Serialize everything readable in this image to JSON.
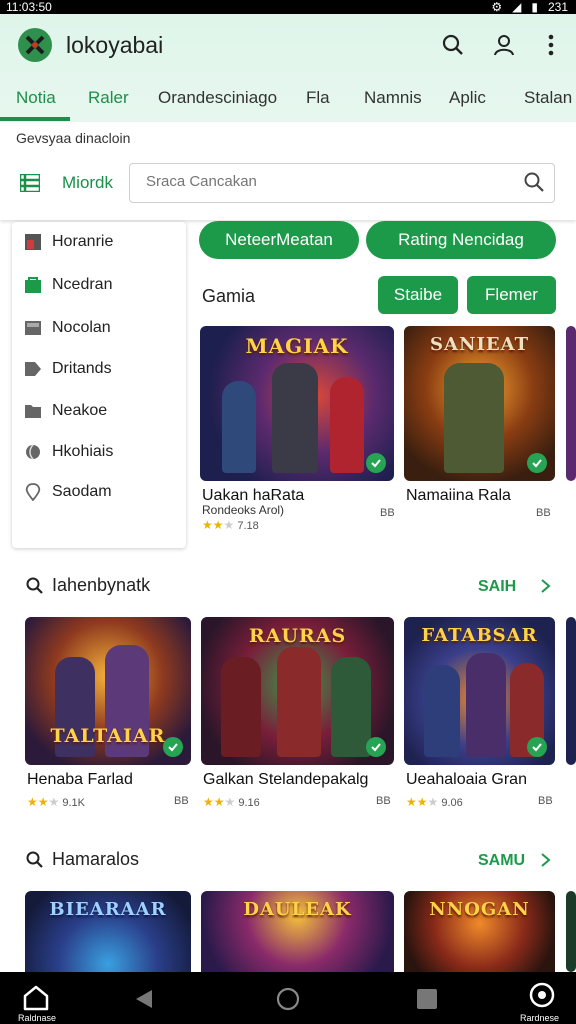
{
  "status": {
    "time": "11:03:50",
    "battery": "231"
  },
  "header": {
    "app_title": "lokoyabai",
    "tabs": [
      "Notia",
      "Raler",
      "Orandesciniago",
      "Fla",
      "Namnis",
      "Aplic",
      "Stalan"
    ]
  },
  "subbar": {
    "subtitle": "Gevsyaa dinacloin",
    "mode_label": "Miordk",
    "search_placeholder": "Sraca Cancakan"
  },
  "sidebar": {
    "items": [
      "Horanrie",
      "Ncedran",
      "Nocolan",
      "Dritands",
      "Neakoe",
      "Hkohiais",
      "Saodam"
    ]
  },
  "chips": [
    "NeteerMeatan",
    "Rating Nencidag"
  ],
  "featured": {
    "title": "Gamia",
    "buttons": [
      "Staibe",
      "Flemer"
    ],
    "cards": [
      {
        "banner": "MAGIAK",
        "title": "Uakan haRata",
        "subtitle": "Rondeoks Arol)",
        "rating": "7.18",
        "meta": "BB"
      },
      {
        "banner": "SANIEAT",
        "title": "Namaiina Rala",
        "subtitle": "",
        "rating": "",
        "meta": "BB"
      }
    ]
  },
  "section1": {
    "title": "Iahenbynatk",
    "see_all": "SAIH",
    "cards": [
      {
        "banner": "TALTAIAR",
        "title": "Henaba Farlad",
        "rating": "9.1K",
        "meta": "BB"
      },
      {
        "banner": "RAURAS",
        "title": "Galkan Stelandepakalg",
        "rating": "9.16",
        "meta": "BB"
      },
      {
        "banner": "FATABSAR",
        "title": "Ueahaloaia Gran",
        "rating": "9.06",
        "meta": "BB"
      }
    ]
  },
  "section2": {
    "title": "Hamaralos",
    "see_all": "SAMU",
    "cards": [
      {
        "banner": "BIEARAAR"
      },
      {
        "banner": "DAULEAK"
      },
      {
        "banner": "NNOGAN"
      }
    ]
  },
  "navbar": {
    "home_label": "Raldnase",
    "right_label": "Rardnese"
  },
  "colors": {
    "accent": "#1c9a4a",
    "header_bg": "#e2f6ec"
  }
}
